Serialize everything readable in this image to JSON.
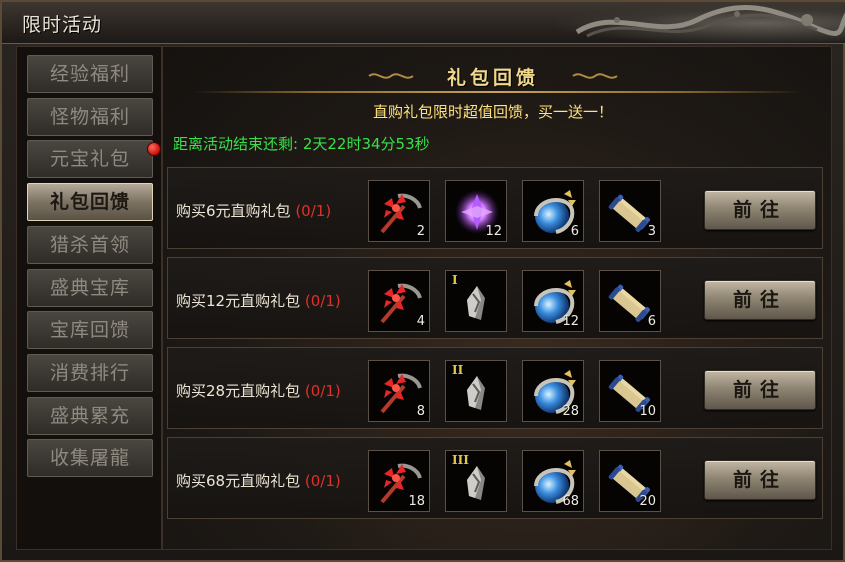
{
  "window": {
    "title": "限时活动"
  },
  "sidebar": {
    "items": [
      {
        "label": "经验福利",
        "active": false,
        "badge": false
      },
      {
        "label": "怪物福利",
        "active": false,
        "badge": false
      },
      {
        "label": "元宝礼包",
        "active": false,
        "badge": true
      },
      {
        "label": "礼包回馈",
        "active": true,
        "badge": false
      },
      {
        "label": "猎杀首领",
        "active": false,
        "badge": false
      },
      {
        "label": "盛典宝库",
        "active": false,
        "badge": false
      },
      {
        "label": "宝库回馈",
        "active": false,
        "badge": false
      },
      {
        "label": "消费排行",
        "active": false,
        "badge": false
      },
      {
        "label": "盛典累充",
        "active": false,
        "badge": false
      },
      {
        "label": "收集屠龍",
        "active": false,
        "badge": false
      }
    ]
  },
  "panel": {
    "title": "礼包回馈",
    "promo": "直购礼包限时超值回馈，买一送一！",
    "countdown": "距离活动结束还剩: 2天22时34分53秒"
  },
  "packages": [
    {
      "label": "购买6元直购礼包",
      "progress": "(0/1)",
      "button": "前往",
      "items": [
        {
          "icon": "red-pickaxe-icon",
          "qty": "2",
          "tier": ""
        },
        {
          "icon": "purple-crystal-icon",
          "qty": "12",
          "tier": ""
        },
        {
          "icon": "blue-dragon-orb-icon",
          "qty": "6",
          "tier": ""
        },
        {
          "icon": "scroll-icon",
          "qty": "3",
          "tier": ""
        }
      ]
    },
    {
      "label": "购买12元直购礼包",
      "progress": "(0/1)",
      "button": "前往",
      "items": [
        {
          "icon": "red-pickaxe-icon",
          "qty": "4",
          "tier": ""
        },
        {
          "icon": "silver-fragment-icon",
          "qty": "",
          "tier": "I"
        },
        {
          "icon": "blue-dragon-orb-icon",
          "qty": "12",
          "tier": ""
        },
        {
          "icon": "scroll-icon",
          "qty": "6",
          "tier": ""
        }
      ]
    },
    {
      "label": "购买28元直购礼包",
      "progress": "(0/1)",
      "button": "前往",
      "items": [
        {
          "icon": "red-pickaxe-icon",
          "qty": "8",
          "tier": ""
        },
        {
          "icon": "silver-fragment-icon",
          "qty": "",
          "tier": "II"
        },
        {
          "icon": "blue-dragon-orb-icon",
          "qty": "28",
          "tier": ""
        },
        {
          "icon": "scroll-icon",
          "qty": "10",
          "tier": ""
        }
      ]
    },
    {
      "label": "购买68元直购礼包",
      "progress": "(0/1)",
      "button": "前往",
      "items": [
        {
          "icon": "red-pickaxe-icon",
          "qty": "18",
          "tier": ""
        },
        {
          "icon": "silver-fragment-icon",
          "qty": "",
          "tier": "III"
        },
        {
          "icon": "blue-dragon-orb-icon",
          "qty": "68",
          "tier": ""
        },
        {
          "icon": "scroll-icon",
          "qty": "20",
          "tier": ""
        }
      ]
    }
  ],
  "colors": {
    "progress": "#e0302a",
    "countdown": "#39e04a",
    "promo": "#ffe27a",
    "title_gold": "#f1d98c"
  }
}
